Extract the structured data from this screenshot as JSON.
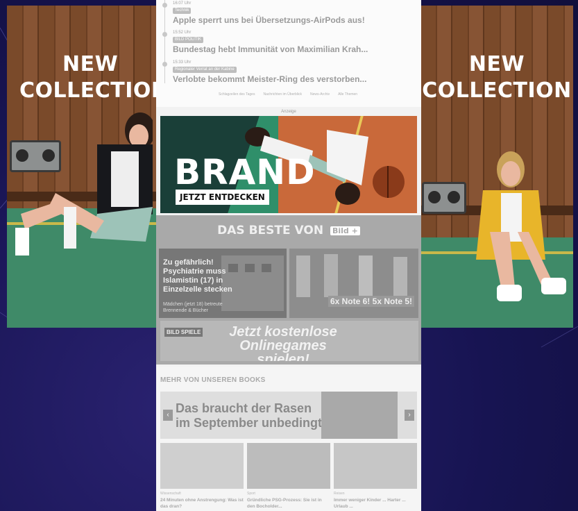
{
  "side_ads": {
    "left": {
      "headline_line1": "NEW",
      "headline_line2": "COLLECTION"
    },
    "right": {
      "headline_line1": "NEW",
      "headline_line2": "COLLECTION"
    }
  },
  "news": {
    "items": [
      {
        "meta": "16:07 Uhr",
        "tag": "Technik",
        "title": "Apple sperrt uns bei Übersetzungs-AirPods aus!"
      },
      {
        "meta": "15:52 Uhr",
        "tag": "BILD POLITIK",
        "title": "Bundestag hebt Immunität von Maximilian Krah..."
      },
      {
        "meta": "15:33 Uhr",
        "tag": "Regionaler Verrat an der Kabine",
        "title": "Verlobte bekommt Meister-Ring des verstorben..."
      }
    ],
    "footer_links": [
      "Schlagzeilen des Tages",
      "Nachrichten im Überblick",
      "News-Archiv",
      "Alle Themen"
    ]
  },
  "ad": {
    "label": "Anzeige",
    "brand": "BRAND",
    "cta": "JETZT ENTDECKEN"
  },
  "best_of": {
    "heading": "DAS BESTE VON",
    "logo": "Bild +",
    "tile1": {
      "headline": "Zu gefährlich! Psychiatrie muss Islamistin (17) in Einzelzelle stecken",
      "sub": "Mädchen (jetzt 18) betreute Brennende & Bücher"
    },
    "tile2": {
      "headline": "6x Note 6! 5x Note 5!"
    },
    "games": {
      "badge": "BILD SPIELE",
      "text_line1": "Jetzt kostenlose",
      "text_line2": "Onlinegames spielen!"
    }
  },
  "books": {
    "heading": "MEHR VON UNSEREN BOOKS",
    "banner": "Das braucht der Rasen im September unbedingt",
    "prev": "‹",
    "next": "›",
    "cards": [
      {
        "kicker": "Wissenschaft",
        "title": "24 Minuten ohne Anstrengung: Was ist das dran?"
      },
      {
        "kicker": "Sport",
        "title": "Gründliche PSG-Prozess: Sie ist in den Bocholder..."
      },
      {
        "kicker": "Reisen",
        "title": "Immer weniger Kinder ... Harter ... Urlaub ..."
      }
    ]
  }
}
